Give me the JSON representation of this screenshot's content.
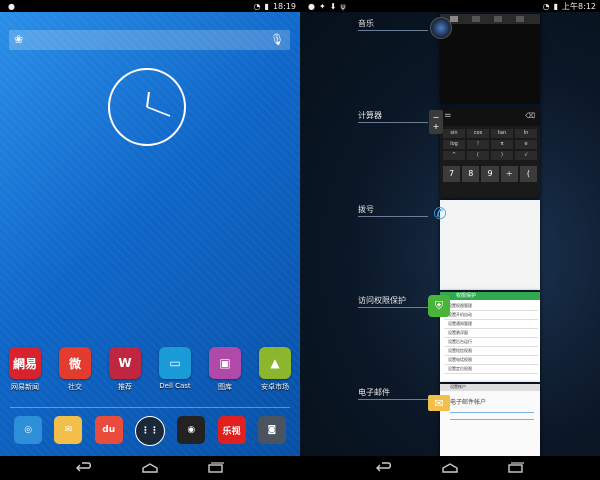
{
  "left_status": {
    "time": "18:19"
  },
  "right_status": {
    "time": "上午8:12"
  },
  "home": {
    "apps": [
      {
        "label": "网易新闻",
        "glyph": "網易",
        "color": "#d7232d"
      },
      {
        "label": "社交",
        "glyph": "微",
        "color": "#e33b2e"
      },
      {
        "label": "推荐",
        "glyph": "W",
        "color": "#c0263f"
      },
      {
        "label": "Dell Cast",
        "glyph": "▭",
        "color": "#1a9bd8"
      },
      {
        "label": "图库",
        "glyph": "▣",
        "color": "#b04aa8"
      },
      {
        "label": "安卓市场",
        "glyph": "▲",
        "color": "#8bb62d"
      }
    ],
    "dock": [
      {
        "name": "browser-icon",
        "glyph": "◎",
        "color": "#2d8fd8"
      },
      {
        "name": "email-icon",
        "glyph": "✉",
        "color": "#f2c04a"
      },
      {
        "name": "map-icon",
        "glyph": "du",
        "color": "#e94b3c"
      },
      {
        "name": "all-apps-icon",
        "glyph": "⋮⋮",
        "color": "#1b2838"
      },
      {
        "name": "music-icon",
        "glyph": "◉",
        "color": "#222"
      },
      {
        "name": "letv-icon",
        "glyph": "乐视",
        "color": "#e02020"
      },
      {
        "name": "camera-icon",
        "glyph": "◙",
        "color": "#4a5360"
      }
    ]
  },
  "recents": [
    {
      "label": "音乐",
      "name": "recent-music"
    },
    {
      "label": "计算器",
      "name": "recent-calculator"
    },
    {
      "label": "拨号",
      "name": "recent-dialer"
    },
    {
      "label": "访问权限保护",
      "name": "recent-permission"
    },
    {
      "label": "电子邮件",
      "name": "recent-email"
    }
  ],
  "calculator": {
    "display": "=",
    "keys_sci": [
      "sin",
      "cos",
      "tan",
      "ln",
      "log",
      "!",
      "π",
      "e",
      "^",
      "(",
      ")",
      "√"
    ],
    "keys_num": [
      "7",
      "8",
      "9",
      "÷",
      "("
    ]
  },
  "permission": {
    "title": "权限保护",
    "rows": [
      "设置权限管理",
      "设置开机自动",
      "设置通知管理",
      "设置悬浮窗",
      "设置后台运行",
      "设置短信权限",
      "设置电话权限",
      "设置定位权限"
    ]
  },
  "email": {
    "header": "设置帐户",
    "body": "电子邮件帐户"
  }
}
